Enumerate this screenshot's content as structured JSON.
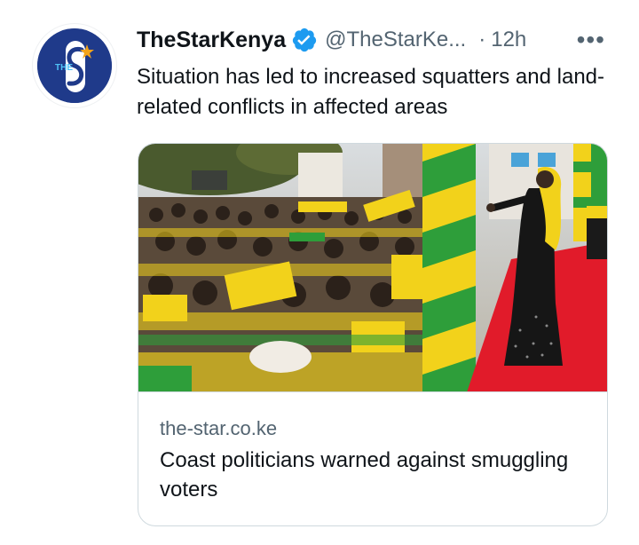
{
  "author": {
    "display_name": "TheStarKenya",
    "handle": "@TheStarKe...",
    "separator": "·",
    "time": "12h",
    "verified_icon": "verified-badge-icon",
    "avatar_text": "THE S",
    "avatar_color": "#1f3a8a"
  },
  "more_label": "•••",
  "tweet_text": "Situation has led to increased squatters and land-related conflicts in affected areas",
  "card": {
    "domain": "the-star.co.ke",
    "title": "Coast politicians warned against smuggling voters",
    "image_description_icon": "rally-photo"
  },
  "colors": {
    "verified": "#1d9bf0",
    "muted": "#536471",
    "text": "#0f1419",
    "border": "#cfd9de",
    "crowd_yellow": "#f2d21b",
    "crowd_green": "#2e9e3a",
    "stage_red": "#e11b2a"
  }
}
